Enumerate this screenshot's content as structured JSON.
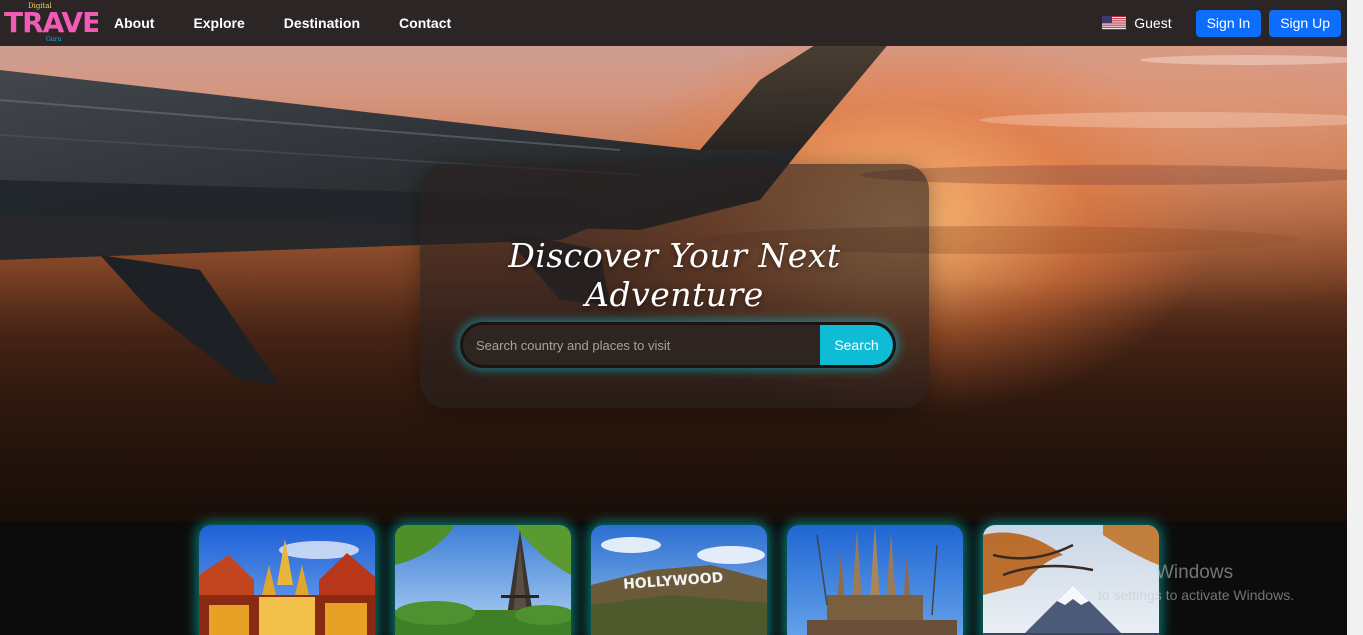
{
  "navbar": {
    "logo_small_top": "Digital",
    "logo_main": "TRAVEL",
    "logo_small_bottom": "Guru",
    "links": [
      "About",
      "Explore",
      "Destination",
      "Contact"
    ],
    "flag_icon": "us-flag-icon",
    "user_label": "Guest",
    "sign_in_label": "Sign In",
    "sign_up_label": "Sign Up"
  },
  "hero": {
    "title": "Discover Your Next Adventure",
    "search_placeholder": "Search country and places to visit",
    "search_value": "",
    "search_button": "Search"
  },
  "destinations": [
    {
      "scene": "thai-temple"
    },
    {
      "scene": "eiffel-tower"
    },
    {
      "scene": "hollywood-sign",
      "sign_text": "HOLLYWOOD"
    },
    {
      "scene": "sagrada-familia"
    },
    {
      "scene": "mount-fuji"
    }
  ],
  "watermark": {
    "title": "Windows",
    "subtitle": "to settings to activate Windows."
  },
  "colors": {
    "navbar_bg": "#2b2625",
    "primary_button": "#0d6efd",
    "search_button": "#0fbcd6",
    "card_glow": "#00d2c8"
  }
}
